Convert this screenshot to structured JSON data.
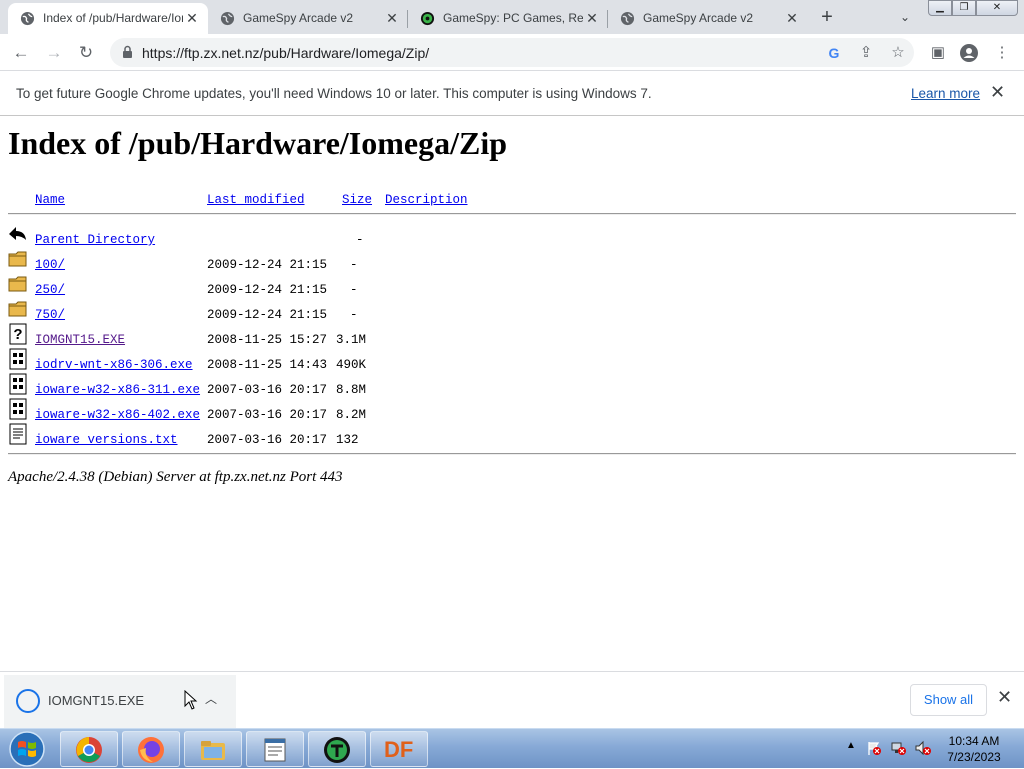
{
  "browser": {
    "tabs": [
      {
        "title": "Index of /pub/Hardware/Iomega/Zip",
        "active": true
      },
      {
        "title": "GameSpy Arcade v2",
        "active": false
      },
      {
        "title": "GameSpy: PC Games, Reviews",
        "active": false
      },
      {
        "title": "GameSpy Arcade v2",
        "active": false
      }
    ],
    "url": "https://ftp.zx.net.nz/pub/Hardware/Iomega/Zip/",
    "infobar": {
      "message": "To get future Google Chrome updates, you'll need Windows 10 or later. This computer is using Windows 7.",
      "link": "Learn more"
    }
  },
  "page": {
    "heading": "Index of /pub/Hardware/Iomega/Zip",
    "columns": {
      "name": "Name",
      "modified": "Last modified",
      "size": "Size",
      "description": "Description"
    },
    "parent": {
      "name": "Parent Directory",
      "size": "-"
    },
    "rows": [
      {
        "name": "100/",
        "modified": "2009-12-24 21:15",
        "size": "-",
        "icon": "folder-icon"
      },
      {
        "name": "250/",
        "modified": "2009-12-24 21:15",
        "size": "-",
        "icon": "folder-icon"
      },
      {
        "name": "750/",
        "modified": "2009-12-24 21:15",
        "size": "-",
        "icon": "folder-icon"
      },
      {
        "name": "IOMGNT15.EXE",
        "modified": "2008-11-25 15:27",
        "size": "3.1M",
        "icon": "unknown-file-icon"
      },
      {
        "name": "iodrv-wnt-x86-306.exe",
        "modified": "2008-11-25 14:43",
        "size": "490K",
        "icon": "binary-file-icon"
      },
      {
        "name": "ioware-w32-x86-311.exe",
        "modified": "2007-03-16 20:17",
        "size": "8.8M",
        "icon": "binary-file-icon"
      },
      {
        "name": "ioware-w32-x86-402.exe",
        "modified": "2007-03-16 20:17",
        "size": "8.2M",
        "icon": "binary-file-icon"
      },
      {
        "name": "ioware_versions.txt",
        "modified": "2007-03-16 20:17",
        "size": "132",
        "icon": "text-file-icon"
      }
    ],
    "footer": "Apache/2.4.38 (Debian) Server at ftp.zx.net.nz Port 443"
  },
  "downloads": {
    "item": "IOMGNT15.EXE",
    "show_all": "Show all"
  },
  "taskbar": {
    "apps": [
      "chrome-icon",
      "firefox-icon",
      "explorer-icon",
      "notepad-icon",
      "gamespy-icon",
      "df-icon"
    ],
    "df_label": "DF",
    "time": "10:34 AM",
    "date": "7/23/2023"
  }
}
